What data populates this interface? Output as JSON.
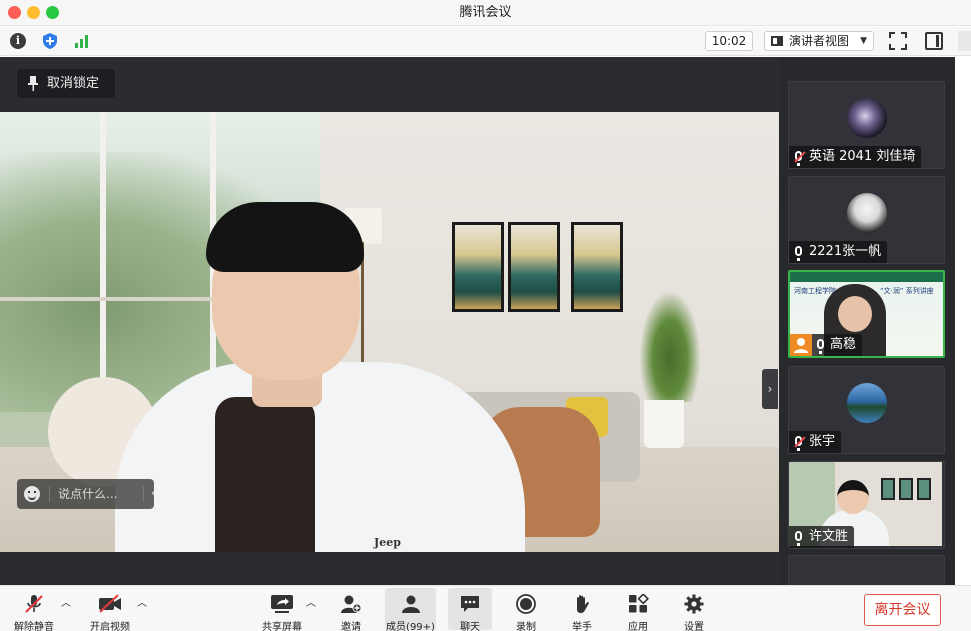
{
  "window": {
    "title": "腾讯会议"
  },
  "toolbar": {
    "info_icon": "info-icon",
    "time": "10:02",
    "view_label": "演讲者视图"
  },
  "stage": {
    "unpin_label": "取消锁定",
    "chat_placeholder": "说点什么...",
    "shirt_logo": "Jeep"
  },
  "participants": [
    {
      "name": "英语 2041 刘佳琦",
      "muted": true
    },
    {
      "name": "2221张一帆",
      "muted": false
    },
    {
      "name": "高稳",
      "muted": false,
      "host": true,
      "active": true
    },
    {
      "name": "张宇",
      "muted": true
    },
    {
      "name": "许文胜",
      "muted": false
    }
  ],
  "slide_text": {
    "left": "河南工程学院",
    "right": "“文·润” 系列讲座"
  },
  "bottom": {
    "mute_label": "解除静音",
    "video_label": "开启视频",
    "share_label": "共享屏幕",
    "invite_label": "邀请",
    "members_label": "成员(99+)",
    "chat_label": "聊天",
    "record_label": "录制",
    "raise_hand_label": "举手",
    "apps_label": "应用",
    "settings_label": "设置",
    "leave_label": "离开会议"
  },
  "colors": {
    "accent_green": "#3ab54a",
    "leave_red": "#d5382b",
    "host_orange": "#f08a24"
  }
}
